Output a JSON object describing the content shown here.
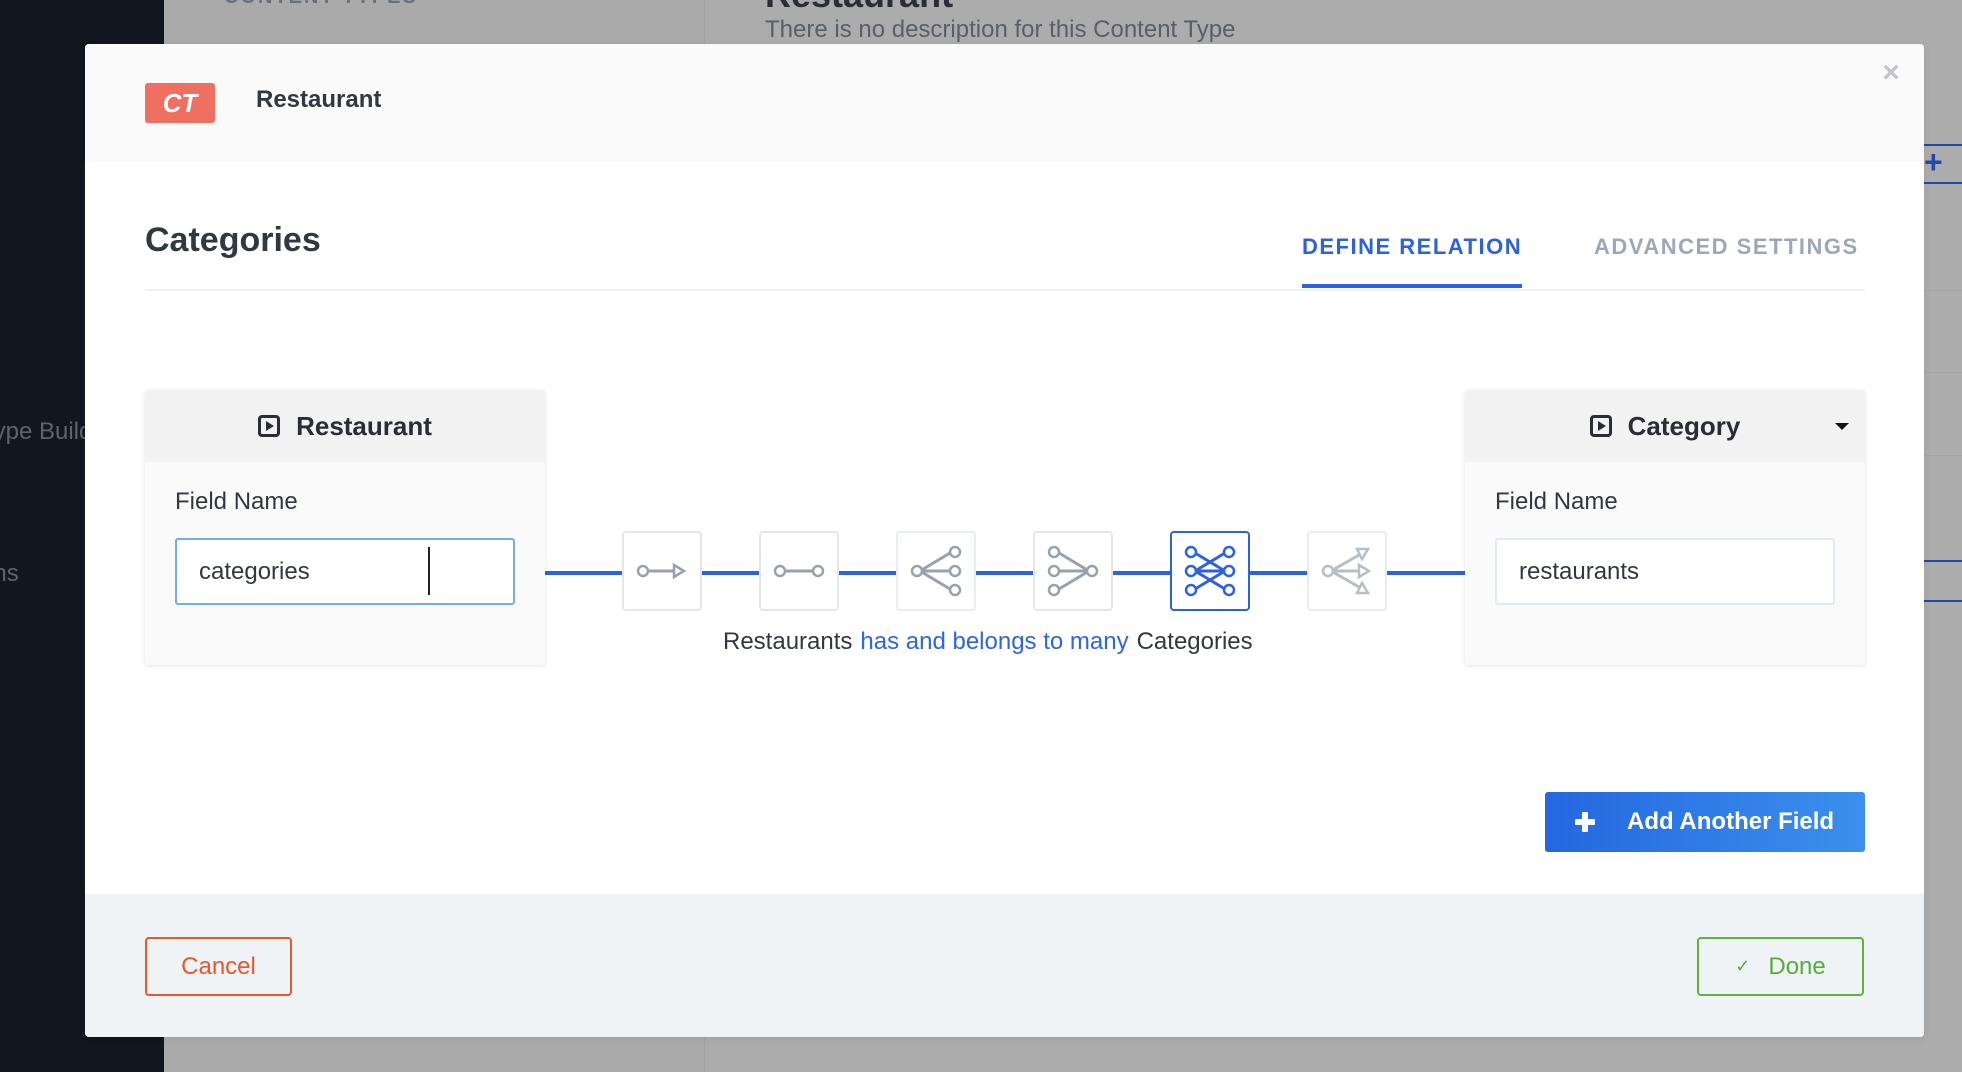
{
  "background": {
    "sidebar_items": [
      "Content Type Builder",
      "Plugins"
    ],
    "subnav_section_title": "CONTENT TYPES",
    "content_type_title": "Restaurant",
    "content_type_description": "There is no description for this Content Type",
    "add_icon": "plus-icon"
  },
  "modal": {
    "badge": "CT",
    "header_title": "Restaurant",
    "close_icon": "×",
    "section_heading": "Categories",
    "tabs": [
      {
        "label": "Define Relation",
        "active": true
      },
      {
        "label": "Advanced Settings",
        "active": false
      }
    ],
    "left_card": {
      "title": "Restaurant",
      "icon": "content-type-icon",
      "field_label": "Field Name",
      "field_value": "categories"
    },
    "right_card": {
      "title": "Category",
      "icon": "content-type-icon",
      "dropdown_icon": "caret-down-icon",
      "field_label": "Field Name",
      "field_value": "restaurants"
    },
    "relation_types": [
      {
        "name": "one-way",
        "active": false
      },
      {
        "name": "one-to-one",
        "active": false
      },
      {
        "name": "one-to-many",
        "active": false
      },
      {
        "name": "many-to-one",
        "active": false
      },
      {
        "name": "many-to-many",
        "active": true
      },
      {
        "name": "many-way",
        "active": false
      }
    ],
    "relation_sentence": {
      "left": "Restaurants",
      "verb": "has and belongs to many",
      "right": "Categories"
    },
    "add_field_label": "Add Another Field",
    "cancel_label": "Cancel",
    "done_label": "Done",
    "done_icon": "✓"
  },
  "colors": {
    "primary": "#2c62dd",
    "badge": "#ef6f60",
    "cancel": "#e1592f",
    "done": "#5fb241"
  }
}
